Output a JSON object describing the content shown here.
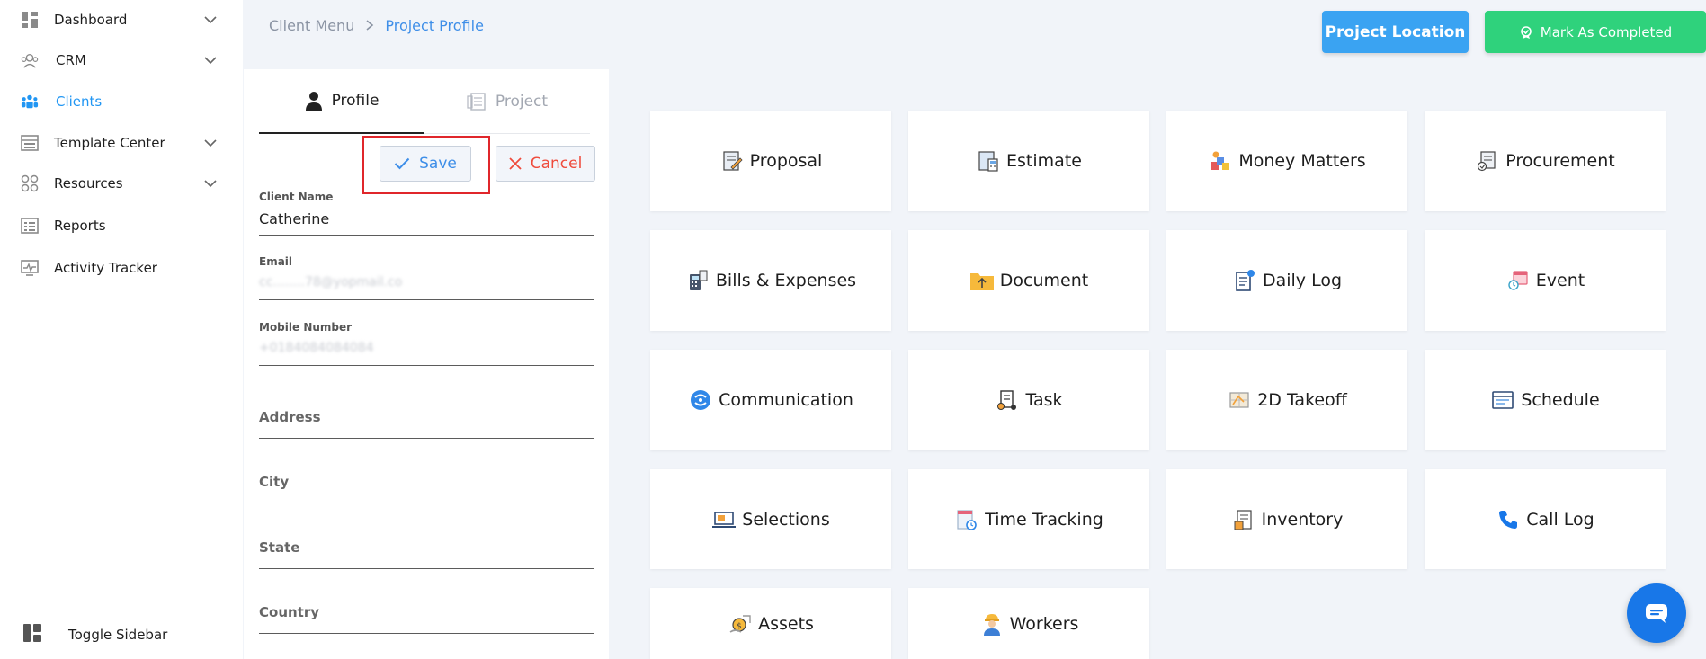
{
  "sidebar": {
    "items": [
      {
        "label": "Dashboard",
        "icon": "dashboard-icon"
      },
      {
        "label": "CRM",
        "icon": "crm-icon"
      },
      {
        "label": "Clients",
        "icon": "clients-icon"
      },
      {
        "label": "Template Center",
        "icon": "template-icon"
      },
      {
        "label": "Resources",
        "icon": "resources-icon"
      },
      {
        "label": "Reports",
        "icon": "reports-icon"
      },
      {
        "label": "Activity Tracker",
        "icon": "activity-icon"
      }
    ],
    "toggle_label": "Toggle Sidebar"
  },
  "breadcrumb": {
    "parent": "Client Menu",
    "current": "Project Profile"
  },
  "header": {
    "location_label": "Project Location",
    "complete_label": "Mark As Completed"
  },
  "panel": {
    "tab_profile": "Profile",
    "tab_project": "Project",
    "save_label": "Save",
    "cancel_label": "Cancel",
    "fields": {
      "client_name_label": "Client Name",
      "client_name_value": "Catherine",
      "email_label": "Email",
      "email_value": "cc........78@yopmail.co",
      "mobile_label": "Mobile Number",
      "mobile_value": "+0184084084084",
      "address_label": "Address",
      "city_label": "City",
      "state_label": "State",
      "country_label": "Country"
    }
  },
  "cards": [
    {
      "label": "Proposal",
      "icon": "proposal-icon"
    },
    {
      "label": "Estimate",
      "icon": "estimate-icon"
    },
    {
      "label": "Money Matters",
      "icon": "money-icon"
    },
    {
      "label": "Procurement",
      "icon": "procurement-icon"
    },
    {
      "label": "Bills & Expenses",
      "icon": "bills-icon"
    },
    {
      "label": "Document",
      "icon": "document-icon"
    },
    {
      "label": "Daily Log",
      "icon": "daily-log-icon"
    },
    {
      "label": "Event",
      "icon": "event-icon"
    },
    {
      "label": "Communication",
      "icon": "communication-icon"
    },
    {
      "label": "Task",
      "icon": "task-icon"
    },
    {
      "label": "2D Takeoff",
      "icon": "takeoff-icon"
    },
    {
      "label": "Schedule",
      "icon": "schedule-icon"
    },
    {
      "label": "Selections",
      "icon": "selections-icon"
    },
    {
      "label": "Time Tracking",
      "icon": "time-tracking-icon"
    },
    {
      "label": "Inventory",
      "icon": "inventory-icon"
    },
    {
      "label": "Call Log",
      "icon": "call-log-icon"
    },
    {
      "label": "Assets",
      "icon": "assets-icon"
    },
    {
      "label": "Workers",
      "icon": "workers-icon"
    }
  ],
  "colors": {
    "accent": "#3e8ee8",
    "location_btn": "#3aa3f2",
    "complete_btn": "#2fd27c",
    "cancel": "#ef4b3c",
    "highlight": "#e0262b",
    "chat": "#1877e8"
  }
}
